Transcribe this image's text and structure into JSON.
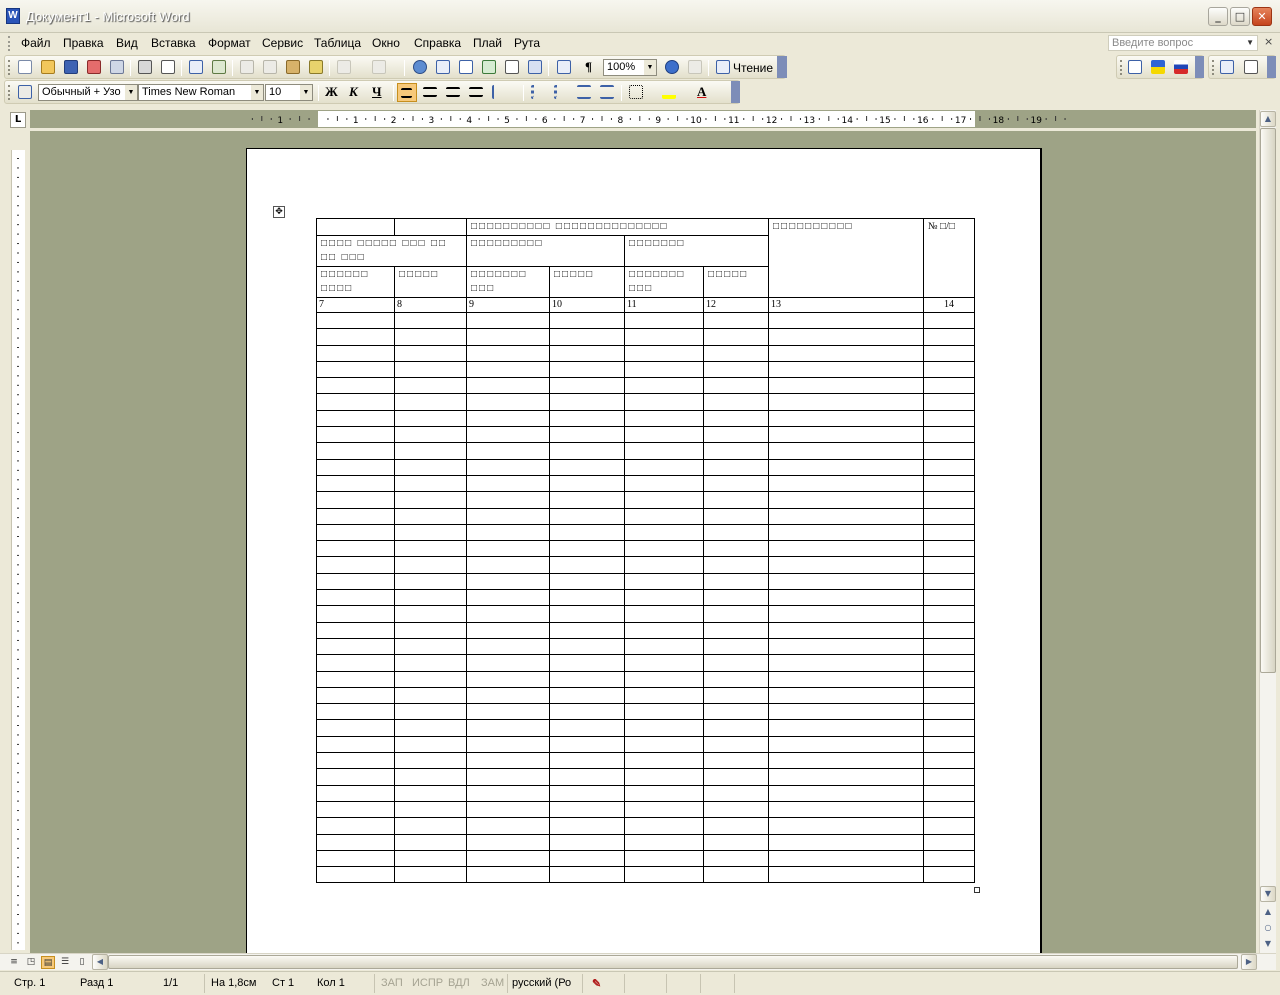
{
  "window": {
    "title": "Документ1 - Microsoft Word",
    "app_icon": "W",
    "minimize": "_",
    "maximize": "□",
    "close": "✕"
  },
  "menu": {
    "items": [
      "Файл",
      "Правка",
      "Вид",
      "Вставка",
      "Формат",
      "Сервис",
      "Таблица",
      "Окно",
      "Справка",
      "Плай",
      "Рута"
    ],
    "ask_placeholder": "Введите вопрос",
    "close": "×"
  },
  "toolbar_standard": {
    "zoom": "100%",
    "reading_label": "Чтение"
  },
  "toolbar_format": {
    "style": "Обычный + Узо",
    "font": "Times New Roman",
    "size": "10",
    "bold": "Ж",
    "italic": "К",
    "underline": "Ч"
  },
  "ruler": {
    "tab_selector": "L",
    "numbers": [
      "1",
      "1",
      "2",
      "3",
      "4",
      "5",
      "6",
      "7",
      "8",
      "9",
      "10",
      "11",
      "12",
      "13",
      "14",
      "15",
      "16",
      "17",
      "18",
      "19"
    ]
  },
  "table": {
    "header_merged": "□□□□□□□□□□ □□□□□□□□□□□□□□",
    "header_col13": "□□□□□□□□□□",
    "header_col14": "№ □/□",
    "header_group1": "□□□□ □□□□□ □□□ □□ □□ □□□",
    "header_group2": "□□□□□□□□□",
    "header_group3": "□□□□□□□",
    "sub": [
      "□□□□□□ □□□□",
      "□□□□□",
      "□□□□□□□ □□□",
      "□□□□□",
      "□□□□□□□ □□□",
      "□□□□□"
    ],
    "numbers": [
      "7",
      "8",
      "9",
      "10",
      "11",
      "12",
      "13",
      "14"
    ],
    "empty_rows": 35
  },
  "status": {
    "page": "Стр. 1",
    "section": "Разд 1",
    "pages": "1/1",
    "at": "На 1,8см",
    "line": "Ст 1",
    "col": "Кол 1",
    "rec": "ЗАП",
    "trk": "ИСПР",
    "ext": "ВДЛ",
    "ovr": "ЗАМ",
    "lang": "русский (Ро"
  }
}
